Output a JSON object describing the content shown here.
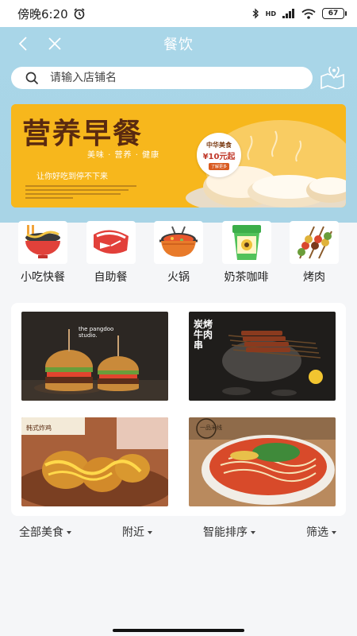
{
  "status_bar": {
    "time": "傍晚6:20",
    "battery": "67",
    "network": "HD"
  },
  "header": {
    "title": "餐饮"
  },
  "search": {
    "placeholder": "请输入店铺名"
  },
  "banner": {
    "title": "营养早餐",
    "tags": "美味 · 营养 · 健康",
    "slogan": "让你好吃到停不下来",
    "badge_name": "中华美食",
    "badge_price": "¥10元起",
    "badge_button": "了解更多",
    "headline": "中华美食"
  },
  "categories": [
    {
      "label": "小吃快餐",
      "icon": "noodle-bowl-icon"
    },
    {
      "label": "自助餐",
      "icon": "steak-icon"
    },
    {
      "label": "火锅",
      "icon": "hotpot-icon"
    },
    {
      "label": "奶茶咖啡",
      "icon": "milk-tea-icon"
    },
    {
      "label": "烤肉",
      "icon": "skewer-icon"
    }
  ],
  "tiles": [
    {
      "name": "burger",
      "caption": "the pangdoo studio."
    },
    {
      "name": "skewers",
      "caption": "炭烤牛肉串"
    },
    {
      "name": "fried-chicken",
      "caption": "韩式炸鸡"
    },
    {
      "name": "noodles",
      "caption": "一品米线"
    }
  ],
  "filters": [
    {
      "label": "全部美食"
    },
    {
      "label": "附近"
    },
    {
      "label": "智能排序"
    },
    {
      "label": "筛选"
    }
  ],
  "colors": {
    "header_bg": "#a8d4e6",
    "banner_bg": "#f7b71c",
    "page_bg": "#f5f6f8"
  }
}
